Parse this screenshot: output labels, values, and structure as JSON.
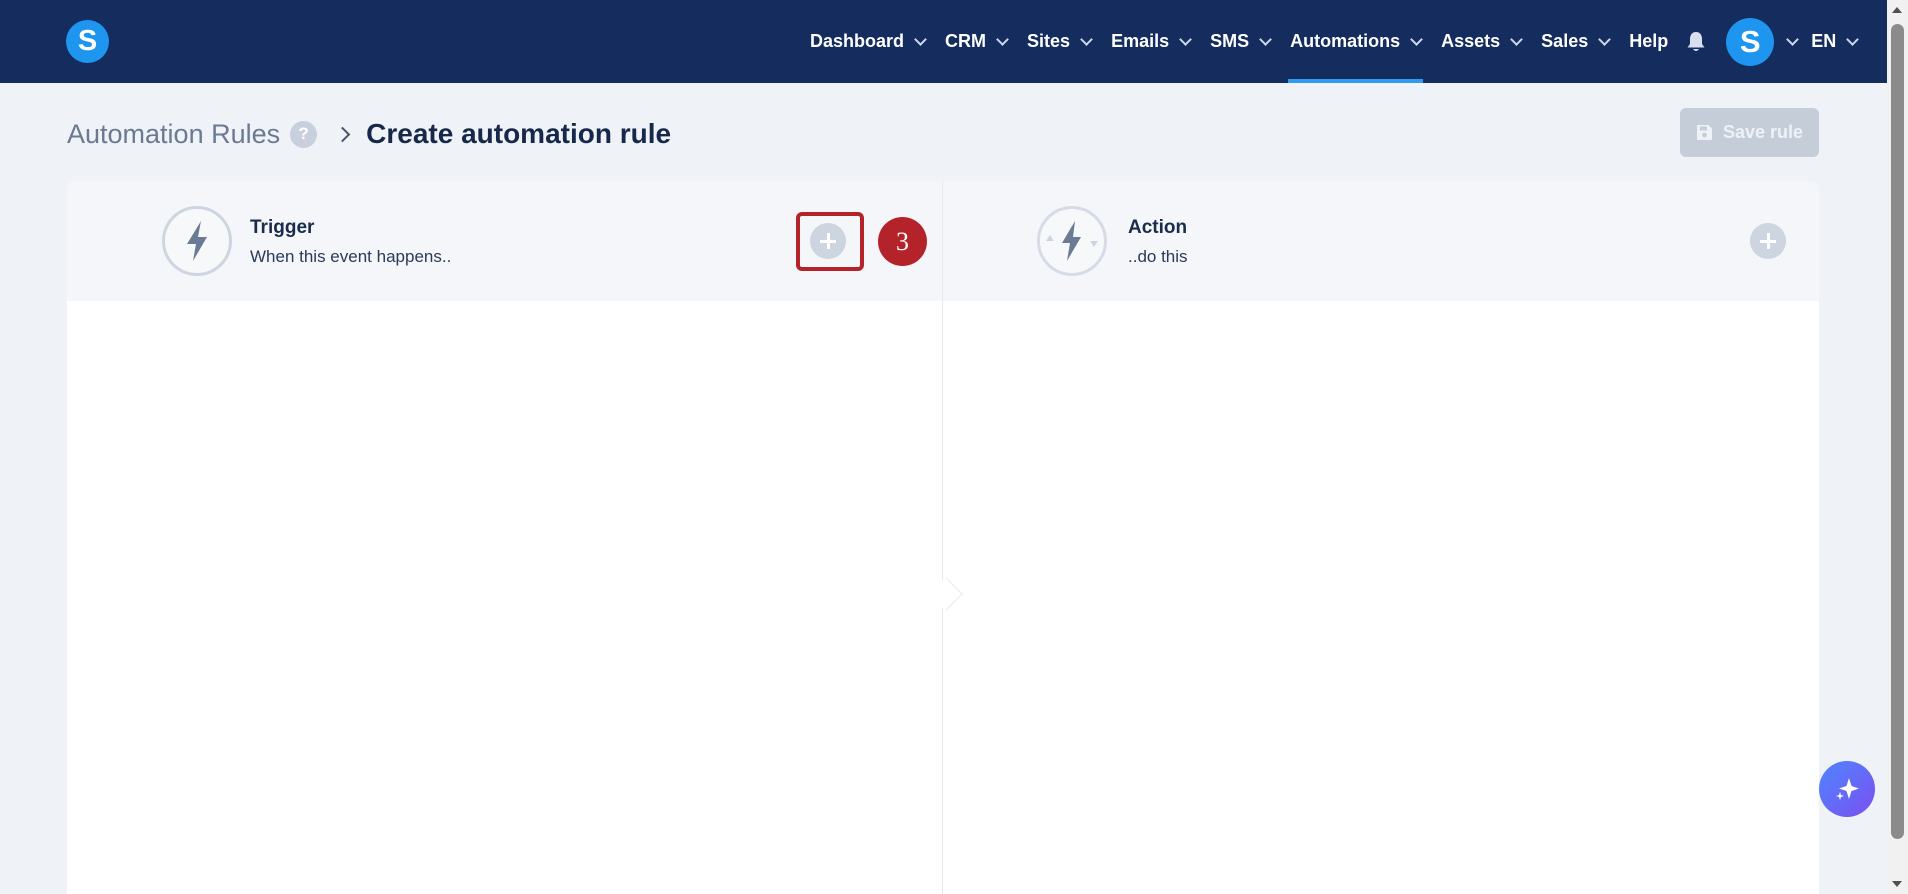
{
  "app": {
    "logo_letter": "S"
  },
  "nav": {
    "items": [
      {
        "label": "Dashboard",
        "dropdown": true,
        "active": false
      },
      {
        "label": "CRM",
        "dropdown": true,
        "active": false
      },
      {
        "label": "Sites",
        "dropdown": true,
        "active": false
      },
      {
        "label": "Emails",
        "dropdown": true,
        "active": false
      },
      {
        "label": "SMS",
        "dropdown": true,
        "active": false
      },
      {
        "label": "Automations",
        "dropdown": true,
        "active": true
      },
      {
        "label": "Assets",
        "dropdown": true,
        "active": false
      },
      {
        "label": "Sales",
        "dropdown": true,
        "active": false
      },
      {
        "label": "Help",
        "dropdown": false,
        "active": false
      }
    ],
    "avatar_letter": "S",
    "language": "EN"
  },
  "breadcrumb": {
    "parent": "Automation Rules",
    "help": "?",
    "current": "Create automation rule"
  },
  "toolbar": {
    "save_label": "Save rule"
  },
  "trigger": {
    "title": "Trigger",
    "subtitle": "When this event happens.."
  },
  "action": {
    "title": "Action",
    "subtitle": "..do this"
  },
  "annotation": {
    "step_number": "3"
  },
  "colors": {
    "nav_bg": "#142c5e",
    "accent": "#1e96f0",
    "highlight": "#b5232a",
    "disabled": "#c4cdd8"
  }
}
